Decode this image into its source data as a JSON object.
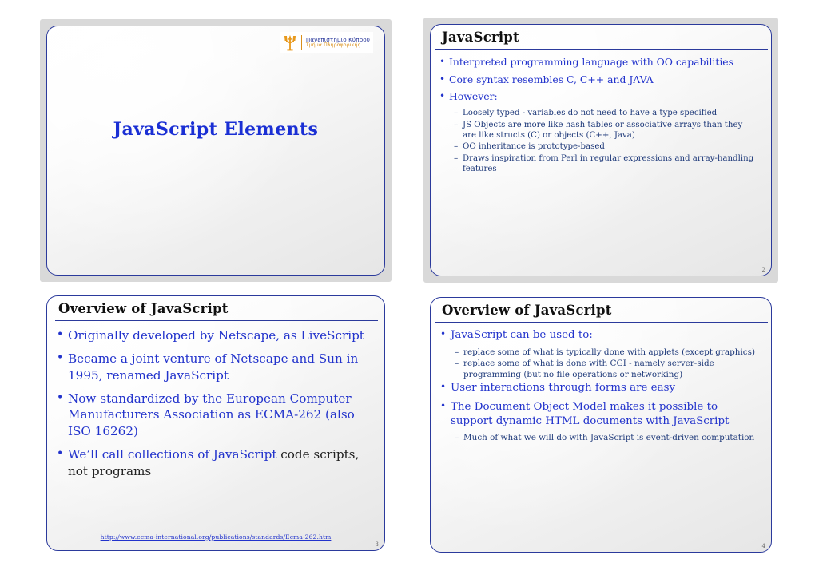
{
  "document": {
    "kind": "lecture-slide-handout",
    "slides_per_page": 4
  },
  "slide1": {
    "title": "JavaScript Elements",
    "logo": {
      "line1": "Πανεπιστήμιο Κύπρου",
      "line2": "Τμήμα Πληροφορικής",
      "mark_color": "#e8991c",
      "text_color": "#2b3a9c"
    }
  },
  "slide2": {
    "title": "JavaScript",
    "page_number": "2",
    "bullets": [
      {
        "level": 1,
        "marker": "•",
        "text": "Interpreted programming language with OO capabilities"
      },
      {
        "level": 1,
        "marker": "•",
        "text": "Core syntax resembles C, C++ and JAVA"
      },
      {
        "level": 1,
        "marker": "•",
        "text": "However:"
      },
      {
        "level": 2,
        "marker": "–",
        "text": "Loosely typed - variables do not need to have a type specified"
      },
      {
        "level": 2,
        "marker": "–",
        "text": "JS Objects are more like hash tables or associative arrays than they are like structs (C) or objects (C++, Java)"
      },
      {
        "level": 2,
        "marker": "–",
        "text": "OO inheritance is prototype-based"
      },
      {
        "level": 2,
        "marker": "–",
        "text": "Draws inspiration from Perl in regular expressions and array-handling features"
      }
    ]
  },
  "slide3": {
    "title": "Overview of JavaScript",
    "page_number": "3",
    "footer_link": "http://www.ecma-international.org/publications/standards/Ecma-262.htm",
    "bullets": [
      {
        "level": 1,
        "marker": "•",
        "text": "Originally developed by Netscape, as LiveScript"
      },
      {
        "level": 1,
        "marker": "•",
        "text": "Became a joint venture of Netscape and Sun in 1995, renamed JavaScript"
      },
      {
        "level": 1,
        "marker": "•",
        "text": "Now standardized by the European Computer Manufacturers Association as ECMA-262 (also ISO 16262)"
      },
      {
        "level": 1,
        "marker": "•",
        "text": "We’ll call collections of JavaScript ",
        "tail": "code scripts, not programs"
      }
    ]
  },
  "slide4": {
    "title": "Overview of JavaScript",
    "page_number": "4",
    "bullets": [
      {
        "level": 1,
        "marker": "•",
        "text": "JavaScript can be used to:"
      },
      {
        "level": 2,
        "marker": "–",
        "text": "replace some of what is typically done with applets (except graphics)"
      },
      {
        "level": 2,
        "marker": "–",
        "text": "replace some of what is done with CGI - namely server-side programming (but no file operations or networking)"
      },
      {
        "level": 1,
        "marker": "•",
        "text": "User interactions through forms are easy"
      },
      {
        "level": 1,
        "marker": "•",
        "text": "The Document Object Model makes it possible to support dynamic HTML documents with JavaScript"
      },
      {
        "level": 2,
        "marker": "–",
        "text": "Much of what we will do with JavaScript is event-driven computation"
      }
    ]
  },
  "colors": {
    "slide_border": "#2b3a9c",
    "primary_bullet_text": "#2233cc",
    "sub_bullet_text": "#1f3a7a",
    "title_text": "#101010",
    "deck_title_text": "#1a2fd4",
    "page_background": "#ffffff"
  }
}
